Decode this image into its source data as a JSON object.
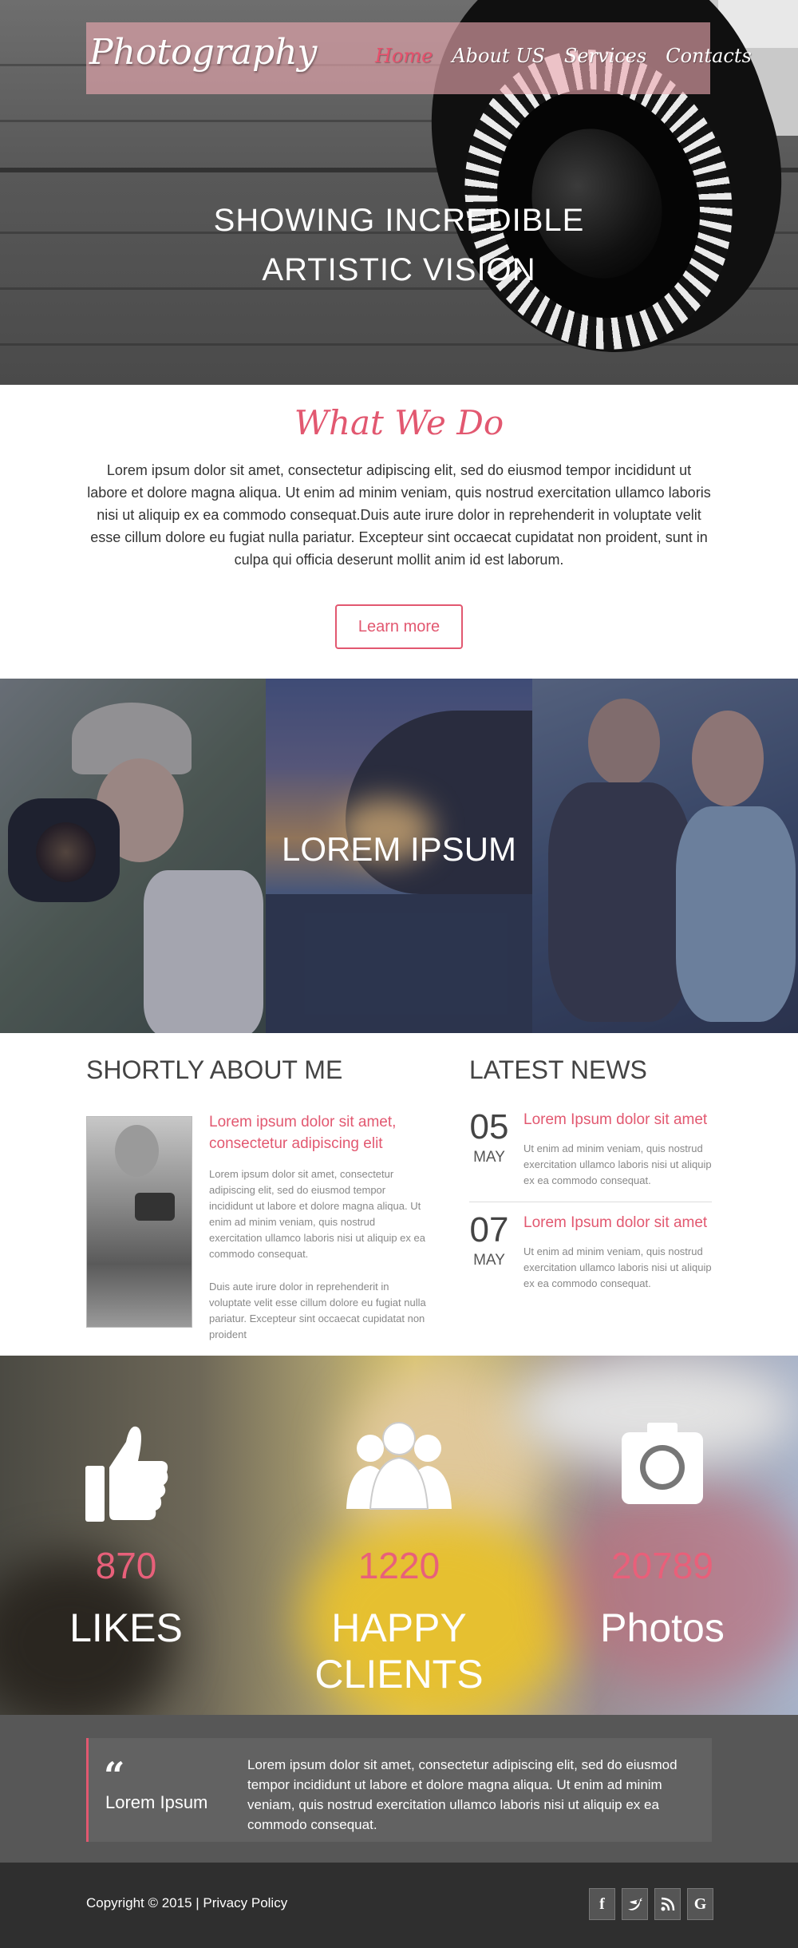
{
  "header": {
    "logo": "Photography",
    "nav": [
      "Home",
      "About US",
      "Services",
      "Contacts"
    ],
    "hero_line1": "SHOWING INCREDIBLE",
    "hero_line2": "ARTISTIC VISION"
  },
  "what_we_do": {
    "title": "What We Do",
    "text": "Lorem ipsum dolor sit amet, consectetur adipiscing elit, sed do eiusmod tempor incididunt ut labore et dolore magna aliqua. Ut enim ad minim veniam, quis nostrud exercitation ullamco laboris nisi ut aliquip ex ea commodo consequat.Duis aute irure dolor in reprehenderit in voluptate velit esse cillum dolore eu fugiat nulla pariatur. Excepteur sint occaecat cupidatat non proident, sunt in culpa qui officia deserunt mollit anim id est laborum.",
    "button": "Learn more"
  },
  "gallery": {
    "title": "LOREM IPSUM"
  },
  "about": {
    "heading": "SHORTLY ABOUT ME",
    "subheading": "Lorem ipsum dolor sit amet, consectetur adipiscing elit",
    "para1": "Lorem ipsum dolor sit amet, consectetur adipiscing elit, sed do eiusmod tempor incididunt ut labore et dolore magna aliqua. Ut enim ad minim veniam, quis nostrud exercitation ullamco laboris nisi ut aliquip ex ea commodo consequat.",
    "para2": "Duis aute irure dolor in reprehenderit in voluptate velit esse cillum dolore eu fugiat nulla pariatur. Excepteur sint occaecat cupidatat non proident"
  },
  "news": {
    "heading": "LATEST NEWS",
    "items": [
      {
        "day": "05",
        "month": "MAY",
        "title": "Lorem Ipsum dolor sit amet",
        "text": "Ut enim ad minim veniam, quis nostrud exercitation ullamco laboris nisi ut aliquip ex ea commodo consequat."
      },
      {
        "day": "07",
        "month": "MAY",
        "title": "Lorem Ipsum dolor sit amet",
        "text": "Ut enim ad minim veniam, quis nostrud exercitation ullamco laboris nisi ut aliquip ex ea commodo consequat."
      }
    ]
  },
  "stats": [
    {
      "icon": "thumbs-up-icon",
      "number": "870",
      "label": "LIKES"
    },
    {
      "icon": "group-icon",
      "number": "1220",
      "label": "HAPPY CLIENTS"
    },
    {
      "icon": "camera-icon",
      "number": "20789",
      "label": "Photos"
    }
  ],
  "quote": {
    "mark": "“",
    "author": "Lorem Ipsum",
    "text": "Lorem ipsum dolor sit amet, consectetur adipiscing elit, sed do eiusmod tempor incididunt ut labore et dolore magna aliqua. Ut enim ad minim veniam, quis nostrud exercitation ullamco laboris nisi ut aliquip ex ea commodo consequat."
  },
  "footer": {
    "copyright": "Copyright © 2015 | Privacy Policy",
    "socials": [
      "f",
      "t",
      "rss",
      "G"
    ]
  },
  "colors": {
    "accent": "#e25870",
    "nav_bar": "#eeaab2",
    "quote_bg": "#575757",
    "footer_bg": "#2f2f2f"
  }
}
